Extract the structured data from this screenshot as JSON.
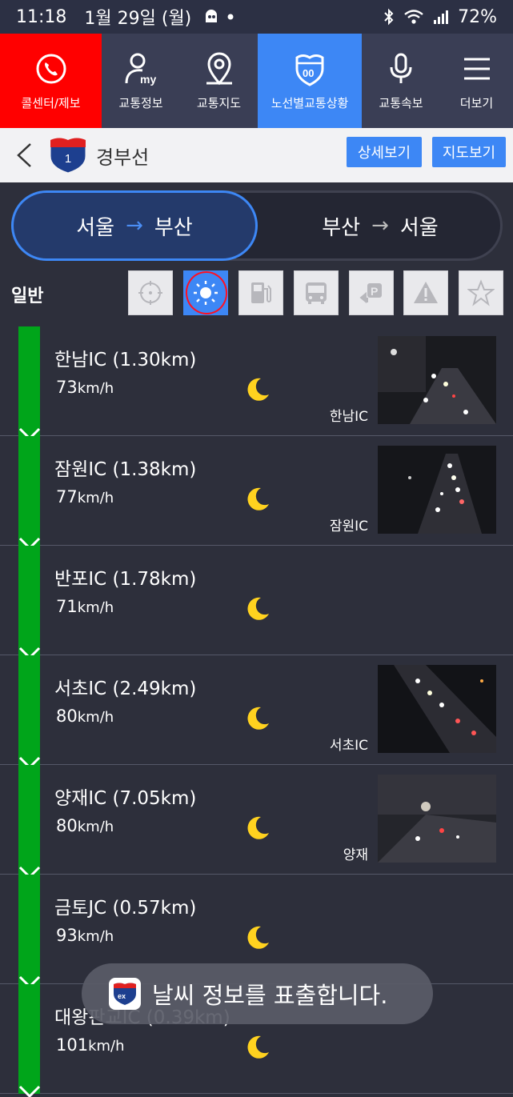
{
  "status_bar": {
    "time": "11:18",
    "date": "1월 29일 (월)",
    "battery": "72%"
  },
  "nav": [
    {
      "label": "콜센터/제보",
      "icon": "phone-icon",
      "state": "highlight-red"
    },
    {
      "label": "교통정보",
      "icon": "my-user-icon",
      "state": "normal"
    },
    {
      "label": "교통지도",
      "icon": "map-pin-icon",
      "state": "normal"
    },
    {
      "label": "노선별교통상황",
      "icon": "route-shield-icon",
      "state": "selected"
    },
    {
      "label": "교통속보",
      "icon": "microphone-icon",
      "state": "normal"
    },
    {
      "label": "더보기",
      "icon": "menu-icon",
      "state": "normal"
    }
  ],
  "route": {
    "shield_number": "1",
    "name": "경부선",
    "detail_button": "상세보기",
    "map_button": "지도보기"
  },
  "direction": {
    "active": {
      "from": "서울",
      "arrow": "→",
      "to": "부산"
    },
    "inactive": {
      "from": "부산",
      "arrow": "→",
      "to": "서울"
    }
  },
  "filter": {
    "label": "일반",
    "buttons": [
      {
        "icon": "location-target-icon",
        "active": false
      },
      {
        "icon": "weather-sun-icon",
        "active": true
      },
      {
        "icon": "gas-station-icon",
        "active": false
      },
      {
        "icon": "bus-icon",
        "active": false
      },
      {
        "icon": "rest-area-parking-icon",
        "active": false
      },
      {
        "icon": "warning-icon",
        "active": false
      },
      {
        "icon": "star-icon",
        "active": false
      }
    ]
  },
  "sections": [
    {
      "title": "한남IC (1.30km)",
      "speed": "73",
      "unit": "km/h",
      "weather": "moon-icon",
      "camera": "한남IC"
    },
    {
      "title": "잠원IC (1.38km)",
      "speed": "77",
      "unit": "km/h",
      "weather": "moon-icon",
      "camera": "잠원IC"
    },
    {
      "title": "반포IC (1.78km)",
      "speed": "71",
      "unit": "km/h",
      "weather": "moon-icon",
      "camera": ""
    },
    {
      "title": "서초IC (2.49km)",
      "speed": "80",
      "unit": "km/h",
      "weather": "moon-icon",
      "camera": "서초IC"
    },
    {
      "title": "양재IC (7.05km)",
      "speed": "80",
      "unit": "km/h",
      "weather": "moon-icon",
      "camera": "양재"
    },
    {
      "title": "금토JC (0.57km)",
      "speed": "93",
      "unit": "km/h",
      "weather": "moon-icon",
      "camera": ""
    },
    {
      "title": "대왕판교IC (0.39km)",
      "speed": "101",
      "unit": "km/h",
      "weather": "moon-icon",
      "camera": ""
    }
  ],
  "toast": {
    "message": "날씨 정보를 표출합니다."
  },
  "colors": {
    "accent": "#3d87f5",
    "call_center": "#ff0000",
    "flow_good": "#00a51a",
    "background": "#2d2f3b"
  }
}
